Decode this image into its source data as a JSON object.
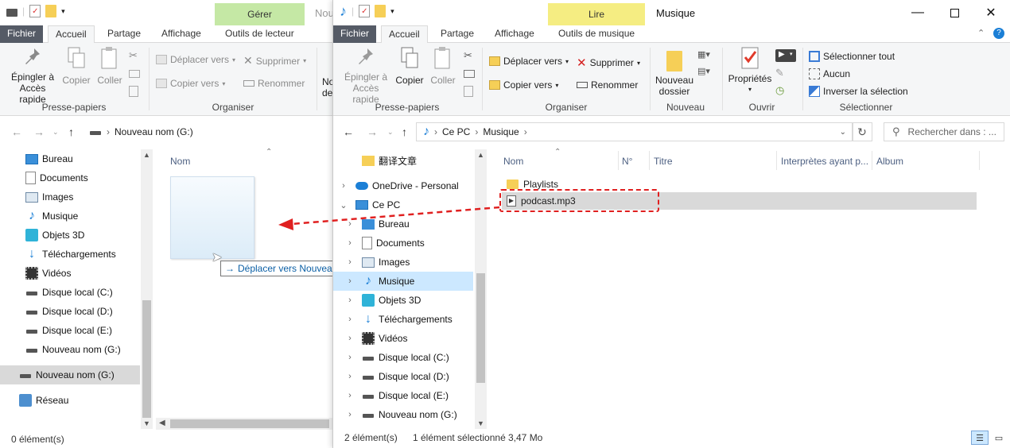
{
  "left_window": {
    "context_tab": "Gérer",
    "title_partial": "Nou",
    "tabs": [
      "Fichier",
      "Accueil",
      "Partage",
      "Affichage",
      "Outils de lecteur"
    ],
    "ribbon": {
      "pin": "Épingler à Accès rapide",
      "copy": "Copier",
      "paste": "Coller",
      "group_clipboard": "Presse-papiers",
      "move_to": "Déplacer vers",
      "copy_to": "Copier vers",
      "delete": "Supprimer",
      "rename": "Renommer",
      "group_organize": "Organiser",
      "new_partial": "No",
      "new_partial2": "de"
    },
    "address": "Nouveau nom (G:)",
    "nav_items": [
      "Bureau",
      "Documents",
      "Images",
      "Musique",
      "Objets 3D",
      "Téléchargements",
      "Vidéos",
      "Disque local (C:)",
      "Disque local (D:)",
      "Disque local (E:)",
      "Nouveau nom (G:)"
    ],
    "nav_selected": "Nouveau nom (G:)",
    "nav_network": "Réseau",
    "column_name": "Nom",
    "drag_tooltip": "Déplacer vers Nouveau nom (G:)",
    "status": "0 élément(s)"
  },
  "right_window": {
    "context_tab": "Lire",
    "title": "Musique",
    "tabs": [
      "Fichier",
      "Accueil",
      "Partage",
      "Affichage",
      "Outils de musique"
    ],
    "ribbon": {
      "pin": "Épingler à Accès rapide",
      "copy": "Copier",
      "paste": "Coller",
      "group_clipboard": "Presse-papiers",
      "move_to": "Déplacer vers",
      "copy_to": "Copier vers",
      "delete": "Supprimer",
      "rename": "Renommer",
      "group_organize": "Organiser",
      "new_folder": "Nouveau dossier",
      "group_new": "Nouveau",
      "properties": "Propriétés",
      "group_open": "Ouvrir",
      "select_all": "Sélectionner tout",
      "select_none": "Aucun",
      "invert_selection": "Inverser la sélection",
      "group_select": "Sélectionner"
    },
    "breadcrumb": [
      "Ce PC",
      "Musique"
    ],
    "search_placeholder": "Rechercher dans : ...",
    "nav_items": [
      {
        "label": "翻译文章",
        "indent": 1,
        "chevron": ""
      },
      {
        "label": "OneDrive - Personal",
        "indent": 0,
        "chevron": ">"
      },
      {
        "label": "Ce PC",
        "indent": 0,
        "chevron": "v"
      },
      {
        "label": "Bureau",
        "indent": 1,
        "chevron": ">"
      },
      {
        "label": "Documents",
        "indent": 1,
        "chevron": ">"
      },
      {
        "label": "Images",
        "indent": 1,
        "chevron": ">"
      },
      {
        "label": "Musique",
        "indent": 1,
        "chevron": ">"
      },
      {
        "label": "Objets 3D",
        "indent": 1,
        "chevron": ">"
      },
      {
        "label": "Téléchargements",
        "indent": 1,
        "chevron": ">"
      },
      {
        "label": "Vidéos",
        "indent": 1,
        "chevron": ">"
      },
      {
        "label": "Disque local (C:)",
        "indent": 1,
        "chevron": ">"
      },
      {
        "label": "Disque local (D:)",
        "indent": 1,
        "chevron": ">"
      },
      {
        "label": "Disque local (E:)",
        "indent": 1,
        "chevron": ">"
      },
      {
        "label": "Nouveau nom (G:)",
        "indent": 1,
        "chevron": ">"
      }
    ],
    "nav_selected": "Musique",
    "columns": [
      "Nom",
      "N°",
      "Titre",
      "Interprètes ayant p...",
      "Album"
    ],
    "files": [
      {
        "name": "Playlists",
        "type": "folder"
      },
      {
        "name": "podcast.mp3",
        "type": "audio"
      }
    ],
    "selected_file": "podcast.mp3",
    "status_count": "2 élément(s)",
    "status_selection": "1 élément sélectionné",
    "status_size": "3,47 Mo"
  },
  "colors": {
    "context_gerer": "#c5e8a5",
    "context_lire": "#f5ed82",
    "file_tab": "#555b66",
    "selection": "#cce8ff",
    "drag_arrow": "#e02020"
  }
}
